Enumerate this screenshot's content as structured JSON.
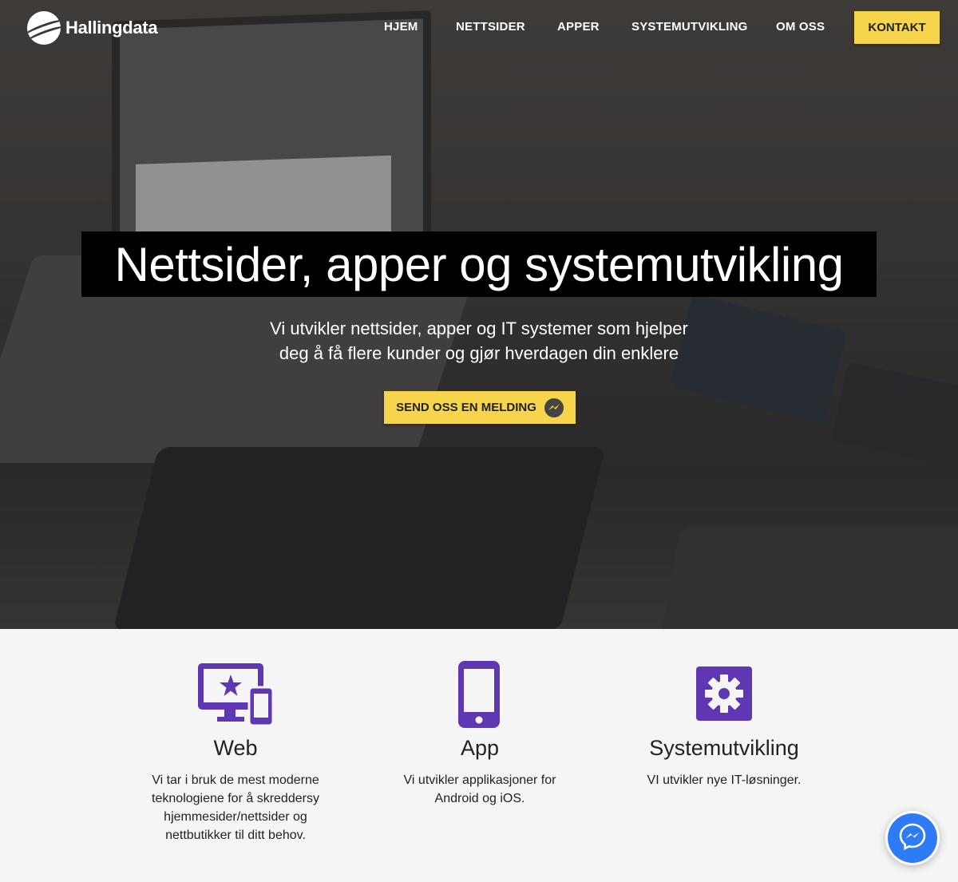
{
  "brand": {
    "name": "Hallingdata"
  },
  "nav": {
    "links": [
      "HJEM",
      "NETTSIDER",
      "APPER",
      "SYSTEMUTVIKLING",
      "OM OSS"
    ],
    "contact_label": "KONTAKT"
  },
  "hero": {
    "title": "Nettsider, apper og systemutvikling",
    "subtitle_line1": "Vi utvikler nettsider, apper og IT systemer som hjelper",
    "subtitle_line2": "deg å få flere kunder og gjør hverdagen din enklere",
    "cta_label": "SEND OSS EN MELDING",
    "cta_icon": "messenger-icon"
  },
  "services": [
    {
      "icon": "devices-star-icon",
      "title": "Web",
      "desc_lines": [
        "Vi tar i bruk de mest moderne",
        "teknologiene for å skreddersy",
        "hjemmesider/nettsider og",
        "nettbutikker til ditt behov."
      ]
    },
    {
      "icon": "phone-icon",
      "title": "App",
      "desc_lines": [
        "Vi utvikler applikasjoner for",
        "Android og iOS."
      ]
    },
    {
      "icon": "gear-icon",
      "title": "Systemutvikling",
      "desc_lines": [
        "VI utvikler nye IT-løsninger."
      ]
    }
  ],
  "colors": {
    "accent": "#f6d44c",
    "icon_purple": "#5f37b3",
    "messenger_blue": "#2e7bf6"
  }
}
